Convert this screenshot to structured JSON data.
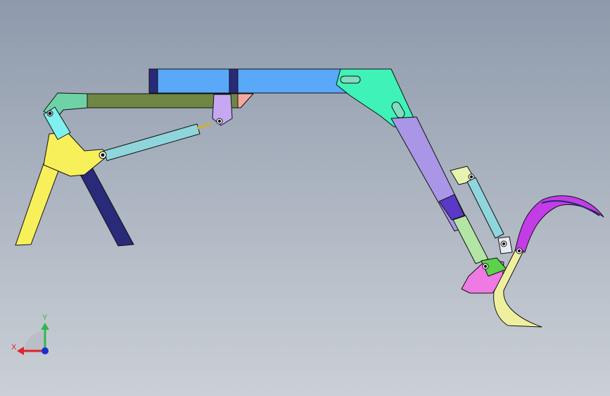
{
  "viewport": {
    "background_top": "#8e9aac",
    "background_bottom": "#cbd0d6"
  },
  "triad": {
    "x_label": "X",
    "y_label": "Y",
    "x_color": "#e0242c",
    "y_color": "#2fb84a",
    "z_color": "#1c2fc8"
  },
  "parts": {
    "beam": "#5aa8f8",
    "clamp": "#2a2a7a",
    "top_link": "#6f8645",
    "left_link": "#6fd2a6",
    "boom_plate": "#3ef2b8",
    "stick": "#a996e6",
    "stick_block": "#5a39c6",
    "front_leg": "#f7f05a",
    "rear_leg": "#2a2a7a",
    "cylinder": "#8fd6dc",
    "claw": "#c43ce8",
    "bucket": "#ef7ae4",
    "tine": "#eef0a0"
  }
}
